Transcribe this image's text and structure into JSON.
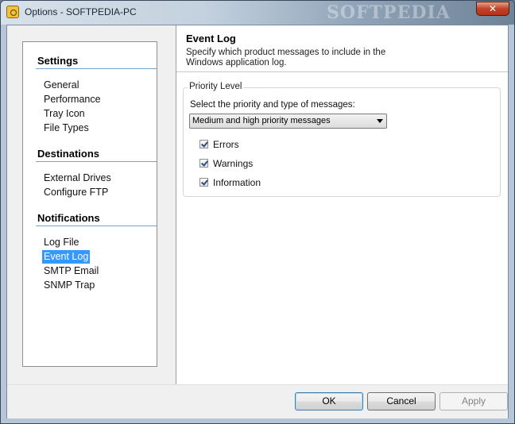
{
  "window": {
    "title": "Options - SOFTPEDIA-PC",
    "watermark": "SOFTPEDIA",
    "close_label": "✕"
  },
  "nav": {
    "sections": [
      {
        "heading": "Settings",
        "items": [
          "General",
          "Performance",
          "Tray Icon",
          "File Types"
        ]
      },
      {
        "heading": "Destinations",
        "items": [
          "External Drives",
          "Configure FTP"
        ]
      },
      {
        "heading": "Notifications",
        "items": [
          "Log File",
          "Event Log",
          "SMTP Email",
          "SNMP Trap"
        ]
      }
    ],
    "selected": "Event Log"
  },
  "content": {
    "title": "Event Log",
    "description": "Specify which product messages to include in the Windows application log.",
    "group_title": "Priority Level",
    "select_label": "Select the priority and type of messages:",
    "dropdown_value": "Medium and high priority messages",
    "checkboxes": [
      {
        "label": "Errors",
        "checked": true
      },
      {
        "label": "Warnings",
        "checked": true
      },
      {
        "label": "Information",
        "checked": true
      }
    ]
  },
  "buttons": {
    "ok": "OK",
    "cancel": "Cancel",
    "apply": "Apply"
  },
  "icons": {
    "app": "app-icon",
    "close": "close-icon",
    "dropdown": "chevron-down-icon",
    "checkbox": "checkmark-icon"
  }
}
